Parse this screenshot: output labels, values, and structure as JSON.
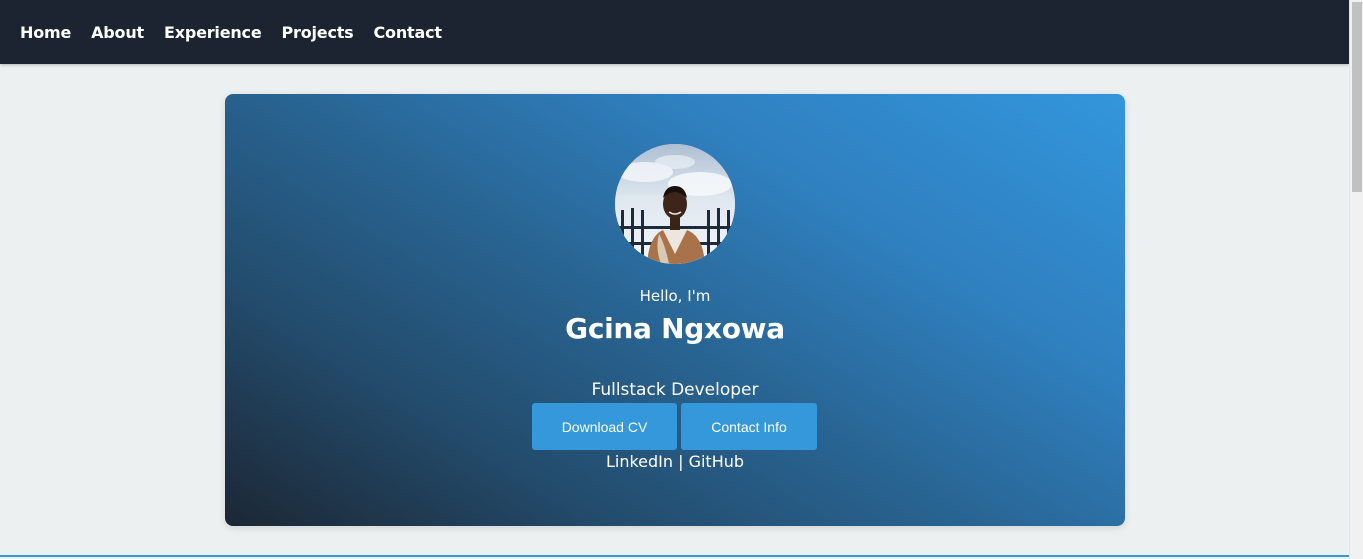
{
  "nav": {
    "items": [
      {
        "label": "Home"
      },
      {
        "label": "About"
      },
      {
        "label": "Experience"
      },
      {
        "label": "Projects"
      },
      {
        "label": "Contact"
      }
    ]
  },
  "hero": {
    "greeting": "Hello, I'm",
    "name": "Gcina Ngxowa",
    "role": "Fullstack Developer",
    "buttons": {
      "download_cv": "Download CV",
      "contact_info": "Contact Info"
    },
    "socials": {
      "linkedin": "LinkedIn",
      "separator": " | ",
      "github": "GitHub"
    }
  },
  "colors": {
    "navbar_bg": "#1b2430",
    "page_bg": "#ecf0f1",
    "accent": "#3498db",
    "gradient_light": "#3396dc",
    "gradient_dark": "#1c2734"
  }
}
